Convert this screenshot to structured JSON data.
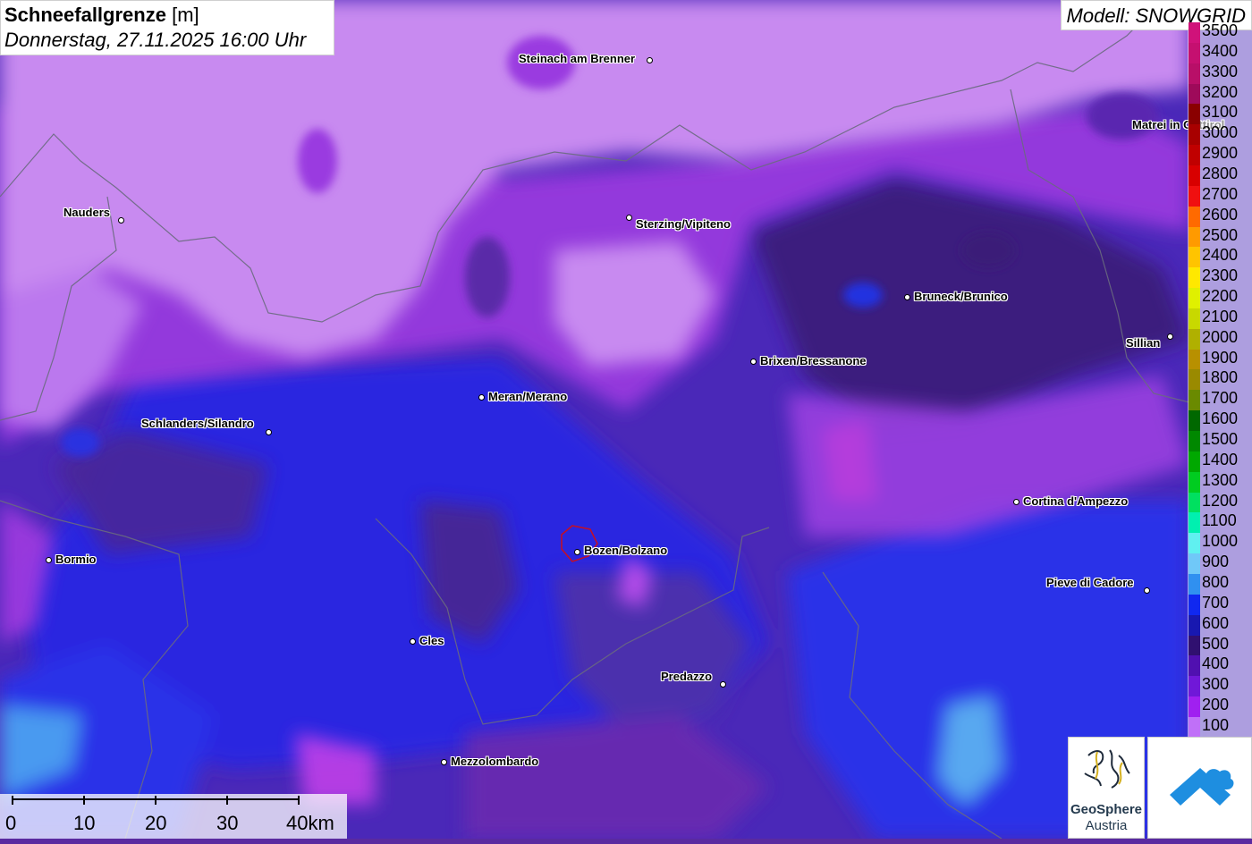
{
  "title": {
    "parameter": "Schneefallgrenze",
    "unit": "[m]",
    "datetime": "Donnerstag, 27.11.2025 16:00 Uhr"
  },
  "model": "Modell: SNOWGRID",
  "cities": [
    {
      "name": "Steinach am Brenner",
      "id": "steinach"
    },
    {
      "name": "Nauders",
      "id": "nauders"
    },
    {
      "name": "Sterzing/Vipiteno",
      "id": "sterzing"
    },
    {
      "name": "Matrei in Osttirol",
      "id": "matrei"
    },
    {
      "name": "Bruneck/Brunico",
      "id": "bruneck"
    },
    {
      "name": "Sillian",
      "id": "sillian"
    },
    {
      "name": "Brixen/Bressanone",
      "id": "brixen"
    },
    {
      "name": "Meran/Merano",
      "id": "meran"
    },
    {
      "name": "Schlanders/Silandro",
      "id": "schlanders"
    },
    {
      "name": "Cortina d'Ampezzo",
      "id": "cortina"
    },
    {
      "name": "Bozen/Bolzano",
      "id": "bozen"
    },
    {
      "name": "Pieve di Cadore",
      "id": "pieve"
    },
    {
      "name": "Bormio",
      "id": "bormio"
    },
    {
      "name": "Cles",
      "id": "cles"
    },
    {
      "name": "Predazzo",
      "id": "predazzo"
    },
    {
      "name": "Mezzolombardo",
      "id": "mezzo"
    }
  ],
  "legend": [
    {
      "label": "3500",
      "color": "#d0127a"
    },
    {
      "label": "3400",
      "color": "#c51070"
    },
    {
      "label": "3300",
      "color": "#b80f68"
    },
    {
      "label": "3200",
      "color": "#9e0a5a"
    },
    {
      "label": "3100",
      "color": "#8a0000"
    },
    {
      "label": "3000",
      "color": "#a80000"
    },
    {
      "label": "2900",
      "color": "#c00000"
    },
    {
      "label": "2800",
      "color": "#d80000"
    },
    {
      "label": "2700",
      "color": "#f01010"
    },
    {
      "label": "2600",
      "color": "#ff6a00"
    },
    {
      "label": "2500",
      "color": "#ff9a00"
    },
    {
      "label": "2400",
      "color": "#ffc400"
    },
    {
      "label": "2300",
      "color": "#ffe800"
    },
    {
      "label": "2200",
      "color": "#e0f000"
    },
    {
      "label": "2100",
      "color": "#c8d800"
    },
    {
      "label": "2000",
      "color": "#b0b000"
    },
    {
      "label": "1900",
      "color": "#b89000"
    },
    {
      "label": "1800",
      "color": "#9a8a00"
    },
    {
      "label": "1700",
      "color": "#6a8a00"
    },
    {
      "label": "1600",
      "color": "#006800"
    },
    {
      "label": "1500",
      "color": "#008800"
    },
    {
      "label": "1400",
      "color": "#00a800"
    },
    {
      "label": "1300",
      "color": "#00cc20"
    },
    {
      "label": "1200",
      "color": "#00e060"
    },
    {
      "label": "1100",
      "color": "#00f0b0"
    },
    {
      "label": "1000",
      "color": "#60f0f0"
    },
    {
      "label": "900",
      "color": "#70c8f8"
    },
    {
      "label": "800",
      "color": "#3090f0"
    },
    {
      "label": "700",
      "color": "#1028f0"
    },
    {
      "label": "600",
      "color": "#1818b0"
    },
    {
      "label": "500",
      "color": "#301070"
    },
    {
      "label": "400",
      "color": "#5010b0"
    },
    {
      "label": "300",
      "color": "#7018d8"
    },
    {
      "label": "200",
      "color": "#a020f0"
    },
    {
      "label": "100",
      "color": "#c070f8"
    }
  ],
  "scalebar": {
    "labels": [
      "0",
      "10",
      "20",
      "30",
      "40km"
    ]
  },
  "logo": {
    "line1": "GeoSphere",
    "line2": "Austria"
  }
}
